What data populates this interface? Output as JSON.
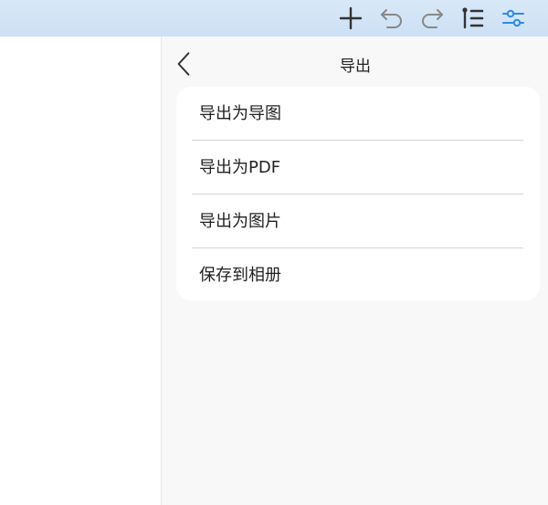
{
  "toolbar": {
    "icons": [
      "plus-icon",
      "undo-icon",
      "redo-icon",
      "outline-icon",
      "settings-sliders-icon"
    ],
    "colors": {
      "icon": "#333333",
      "icon_muted": "#888888",
      "icon_active": "#2f8be6",
      "bar": "#d3e4f6"
    }
  },
  "panel": {
    "title": "导出",
    "back_icon": "chevron-left-icon",
    "items": [
      {
        "label": "导出为导图"
      },
      {
        "label": "导出为PDF"
      },
      {
        "label": "导出为图片"
      },
      {
        "label": "保存到相册"
      }
    ]
  }
}
